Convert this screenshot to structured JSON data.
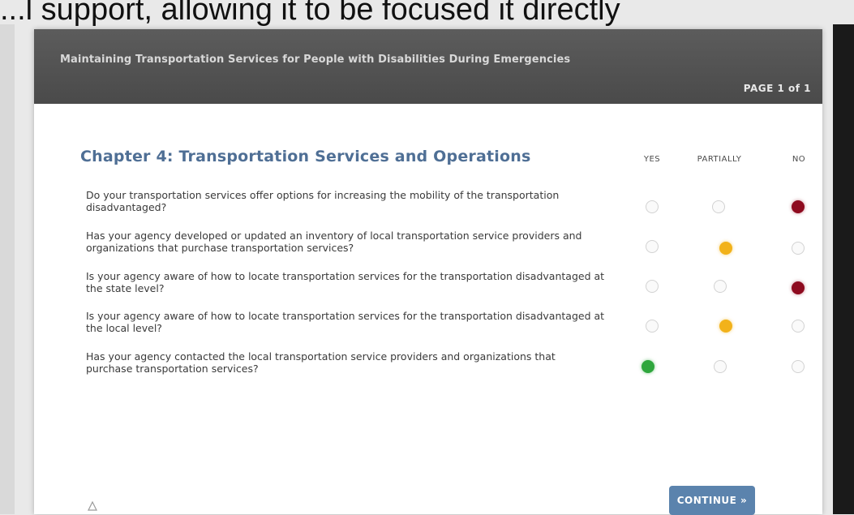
{
  "video_caption": "...l support, allowing it to be focused it directly",
  "window": {
    "title": "Maintaining Transportation Services for People with Disabilities During Emergencies",
    "page_indicator": "PAGE 1 of 1"
  },
  "chapter_title": "Chapter 4: Transportation Services and Operations",
  "columns": {
    "yes": "YES",
    "partially": "PARTIALLY",
    "no": "NO"
  },
  "questions": [
    {
      "text": "Do your transportation services offer options for increasing the mobility of the transportation disadvantaged?",
      "answer": "no"
    },
    {
      "text": "Has your agency developed or updated an inventory of local transportation service providers and organizations that purchase transportation services?",
      "answer": "partially"
    },
    {
      "text": "Is your agency aware of how to locate transportation services for the transportation disadvantaged at the state level?",
      "answer": "no"
    },
    {
      "text": "Is your agency aware of how to locate transportation services for the transportation disadvantaged at the local level?",
      "answer": "partially"
    },
    {
      "text": "Has your agency contacted the local transportation service providers and organizations that purchase transportation services?",
      "answer": "yes"
    }
  ],
  "continue_label": "CONTINUE »",
  "colors": {
    "no": "#8e0a1f",
    "partially": "#f2b21b",
    "yes": "#2fa63d",
    "title": "#4f6f95",
    "button": "#5b83ad"
  }
}
